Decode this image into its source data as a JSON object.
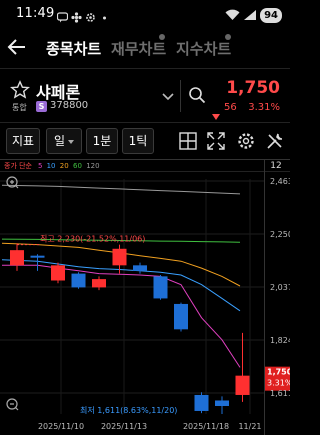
{
  "status": {
    "time": "11:49",
    "battery": "94"
  },
  "nav": {
    "tabs": [
      {
        "label": "종목차트",
        "active": true
      },
      {
        "label": "재무차트",
        "active": false
      },
      {
        "label": "지수차트",
        "active": false
      }
    ]
  },
  "stock": {
    "name": "샤페론",
    "market": "통합",
    "code_chip": "S",
    "code": "378800",
    "price": "1,750",
    "change": "56",
    "change_pct": "3.31%",
    "color_down": "#ff4a4a"
  },
  "toolbar": {
    "indicator_label": "지표",
    "period_label": "일",
    "minute_label": "1분",
    "tick_label": "1틱",
    "icons": [
      "layout-grid-icon",
      "expand-icon",
      "settings-icon",
      "tools-icon"
    ]
  },
  "chart_data": {
    "type": "candlestick",
    "moving_average_legend": {
      "prefix": "종가 단순",
      "periods": [
        {
          "label": "5",
          "color": "#e040c0"
        },
        {
          "label": "10",
          "color": "#3aa0ff"
        },
        {
          "label": "20",
          "color": "#f0a020"
        },
        {
          "label": "60",
          "color": "#40c040"
        },
        {
          "label": "120",
          "color": "#999999"
        }
      ]
    },
    "candle_count_label": "12",
    "y_ticks": [
      "2,463",
      "2,250",
      "2,037",
      "1,824",
      "1,611"
    ],
    "y_range": [
      1611,
      2463
    ],
    "x_ticks": [
      "2025/11/10",
      "2025/11/13",
      "2025/11/18",
      "11/21"
    ],
    "high_annotation": "최고 2,230(-21.52%,11/06)",
    "low_annotation": "최저 1,611(8.63%,11/20)",
    "last_price_label": "1,750",
    "last_pct_label": "3.31%",
    "candles": [
      {
        "open": 2150,
        "close": 2205,
        "high": 2230,
        "low": 2130
      },
      {
        "open": 2185,
        "close": 2180,
        "high": 2190,
        "low": 2130
      },
      {
        "open": 2095,
        "close": 2150,
        "high": 2160,
        "low": 2085
      },
      {
        "open": 2120,
        "close": 2070,
        "high": 2125,
        "low": 2065
      },
      {
        "open": 2070,
        "close": 2100,
        "high": 2110,
        "low": 2060
      },
      {
        "open": 2150,
        "close": 2210,
        "high": 2225,
        "low": 2120
      },
      {
        "open": 2150,
        "close": 2130,
        "high": 2160,
        "low": 2120
      },
      {
        "open": 2110,
        "close": 2030,
        "high": 2115,
        "low": 2025
      },
      {
        "open": 2010,
        "close": 1918,
        "high": 2015,
        "low": 1910
      },
      {
        "open": 1680,
        "close": 1622,
        "high": 1690,
        "low": 1614
      },
      {
        "open": 1660,
        "close": 1640,
        "high": 1675,
        "low": 1611
      },
      {
        "open": 1680,
        "close": 1750,
        "high": 1905,
        "low": 1655
      }
    ],
    "ma_series": [
      {
        "period": "5",
        "color": "#e040c0",
        "values": [
          2150,
          2150,
          2140,
          2130,
          2120,
          2118,
          2115,
          2110,
          2080,
          1960,
          1880,
          1780
        ]
      },
      {
        "period": "10",
        "color": "#3aa0ff",
        "values": [
          2170,
          2165,
          2155,
          2145,
          2138,
          2135,
          2130,
          2125,
          2115,
          2080,
          2030,
          1985
        ]
      },
      {
        "period": "20",
        "color": "#f0a020",
        "values": [
          2230,
          2225,
          2220,
          2215,
          2205,
          2195,
          2185,
          2175,
          2165,
          2140,
          2110,
          2075
        ]
      },
      {
        "period": "60",
        "color": "#40c040",
        "values": [
          2245,
          2244,
          2243,
          2242,
          2241,
          2240,
          2239,
          2238,
          2237,
          2236,
          2235,
          2234
        ]
      },
      {
        "period": "120",
        "color": "#999999",
        "values": [
          2440,
          2438,
          2436,
          2433,
          2430,
          2427,
          2424,
          2421,
          2418,
          2415,
          2412,
          2409
        ]
      }
    ]
  }
}
